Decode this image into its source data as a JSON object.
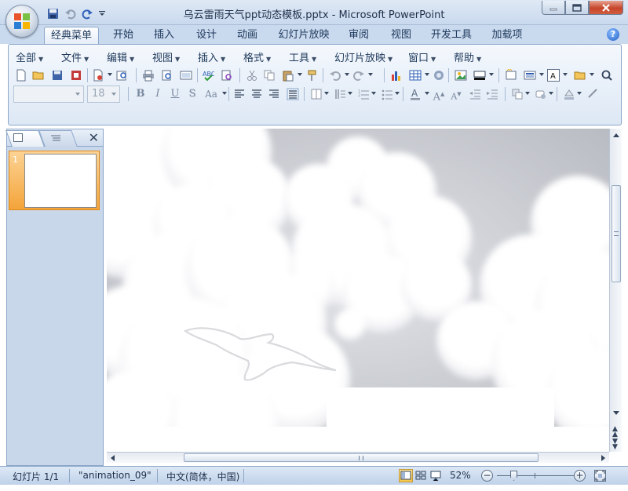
{
  "window": {
    "title": "乌云雷雨天气ppt动态模板.pptx - Microsoft PowerPoint"
  },
  "quick_access": [
    "save-icon",
    "undo-icon",
    "redo-icon",
    "customize-qat-icon"
  ],
  "ribbon_tabs": [
    {
      "label": "经典菜单",
      "active": true
    },
    {
      "label": "开始"
    },
    {
      "label": "插入"
    },
    {
      "label": "设计"
    },
    {
      "label": "动画"
    },
    {
      "label": "幻灯片放映"
    },
    {
      "label": "审阅"
    },
    {
      "label": "视图"
    },
    {
      "label": "开发工具"
    },
    {
      "label": "加载项"
    }
  ],
  "classic_menu": [
    "全部",
    "文件",
    "编辑",
    "视图",
    "插入",
    "格式",
    "工具",
    "幻灯片放映",
    "窗口",
    "帮助"
  ],
  "font": {
    "name": "",
    "size": "18"
  },
  "slides_panel": {
    "slide_number": "1"
  },
  "status_bar": {
    "slide_info": "幻灯片 1/1",
    "theme": "\"animation_09\"",
    "language": "中文(简体，中国)",
    "zoom": "52%"
  },
  "colors": {
    "ribbon_blue": "#c9d9ee",
    "slide_bg": "#cfd2d8",
    "cloud": "#ffffff",
    "selected_thumb": "#f4a43a"
  }
}
